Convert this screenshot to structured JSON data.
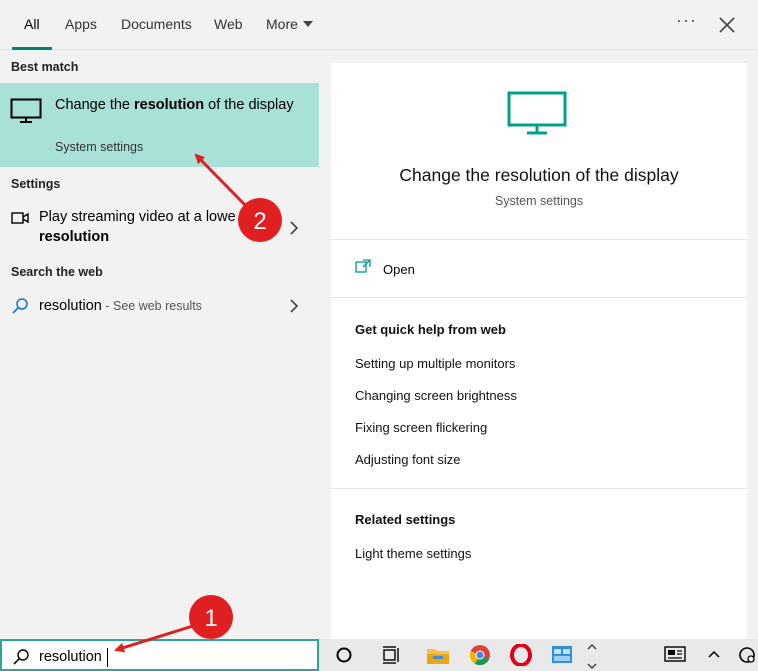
{
  "tabs": [
    {
      "label": "All"
    },
    {
      "label": "Apps"
    },
    {
      "label": "Documents"
    },
    {
      "label": "Web"
    },
    {
      "label": "More"
    }
  ],
  "left": {
    "best_match_heading": "Best match",
    "best_match": {
      "title_pre": "Change the ",
      "title_bold": "resolution",
      "title_post": " of the display",
      "subtitle": "System settings",
      "icon": "monitor-icon"
    },
    "settings_heading": "Settings",
    "settings_item": {
      "line1": "Play streaming video at a lowe",
      "line2": "resolution",
      "icon": "video-icon"
    },
    "web_heading": "Search the web",
    "web_item": {
      "query": "resolution",
      "suffix": " - See web results",
      "icon": "search-icon"
    }
  },
  "right": {
    "title": "Change the resolution of the display",
    "subtitle": "System settings",
    "open_label": "Open",
    "help_heading": "Get quick help from web",
    "help_links": [
      "Setting up multiple monitors",
      "Changing screen brightness",
      "Fixing screen flickering",
      "Adjusting font size"
    ],
    "related_heading": "Related settings",
    "related_links": [
      "Light theme settings"
    ]
  },
  "search": {
    "value": "resolution"
  },
  "annotations": {
    "badge1": "1",
    "badge2": "2"
  },
  "colors": {
    "accent": "#008575",
    "highlight": "#a9e0d8",
    "icon_teal": "#00a08a",
    "annotation_red": "#e02020"
  }
}
